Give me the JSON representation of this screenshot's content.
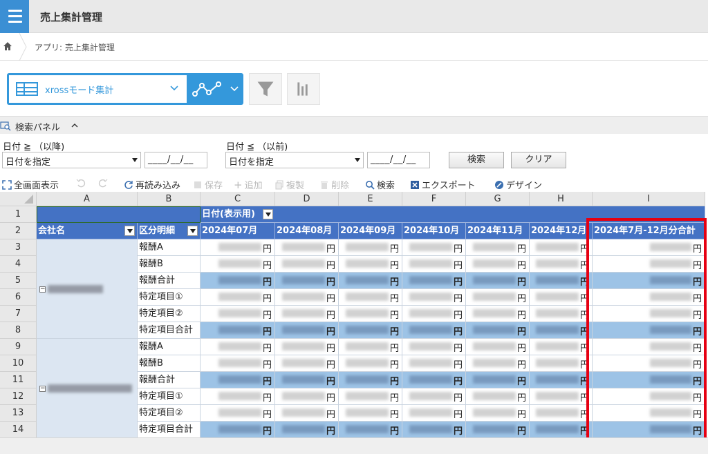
{
  "app": {
    "title": "売上集計管理"
  },
  "breadcrumb": {
    "text": "アプリ: 売上集計管理"
  },
  "view": {
    "selected": "xrossモード集計"
  },
  "search_panel": {
    "label": "検索パネル",
    "date_from_label": "日付 ≧ （以降)",
    "date_to_label": "日付 ≦ （以前)",
    "date_from_select": "日付を指定",
    "date_to_select": "日付を指定",
    "date_from_value": "____/__/__",
    "date_to_value": "____/__/__",
    "search_button": "検索",
    "clear_button": "クリア"
  },
  "actions": {
    "fullscreen": "全画面表示",
    "reload": "再読み込み",
    "save": "保存",
    "add": "追加",
    "copy": "複製",
    "delete": "削除",
    "search": "検索",
    "export": "エクスポート",
    "design": "デザイン"
  },
  "grid": {
    "columns": [
      "A",
      "B",
      "C",
      "D",
      "E",
      "F",
      "G",
      "H",
      "I"
    ],
    "rows": [
      "1",
      "2",
      "3",
      "4",
      "5",
      "6",
      "7",
      "8",
      "9",
      "10",
      "11",
      "12",
      "13",
      "14"
    ],
    "date_header": "日付(表示用)",
    "company_header": "会社名",
    "category_header": "区分明細",
    "months": [
      "2024年07月",
      "2024年08月",
      "2024年09月",
      "2024年10月",
      "2024年11月",
      "2024年12月"
    ],
    "total_header": "2024年7月-12月分合計",
    "items": [
      "報酬A",
      "報酬B",
      "報酬合計",
      "特定項目①",
      "特定項目②",
      "特定項目合計",
      "報酬A",
      "報酬B",
      "報酬合計",
      "特定項目①",
      "特定項目②",
      "特定項目合計"
    ],
    "yen": "円"
  },
  "colors": {
    "header_blue": "#4472c4",
    "total_row": "#9dc3e6",
    "accent": "#3498db",
    "highlight": "#e60012"
  }
}
